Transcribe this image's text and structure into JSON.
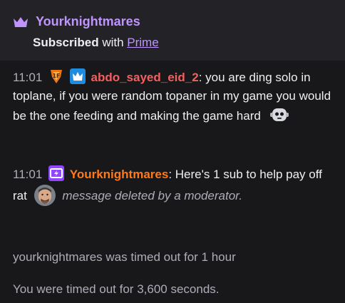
{
  "sub_notice": {
    "username": "Yourknightmares",
    "bold_text": "Subscribed",
    "with_text": " with ",
    "link_text": "Prime"
  },
  "messages": [
    {
      "timestamp": "11:01",
      "username": "abdo_sayed_eid_2",
      "text": ": you are ding solo in toplane, if you were random topaner in my game you would be the one feeding and making the game hard"
    },
    {
      "timestamp": "11:01",
      "username": "Yourknightmares",
      "text": ": Here's 1 sub to help pay off rat",
      "deleted_text": "message deleted by a moderator."
    }
  ],
  "system_messages": [
    "yourknightmares was timed out for 1 hour",
    "You were timed out for 3,600 seconds."
  ],
  "colors": {
    "background": "#18181b",
    "notice_bg": "#232327",
    "purple": "#bf94ff",
    "user1": "#f35f5f",
    "user2": "#ff7a1a",
    "muted": "#adadb8"
  }
}
